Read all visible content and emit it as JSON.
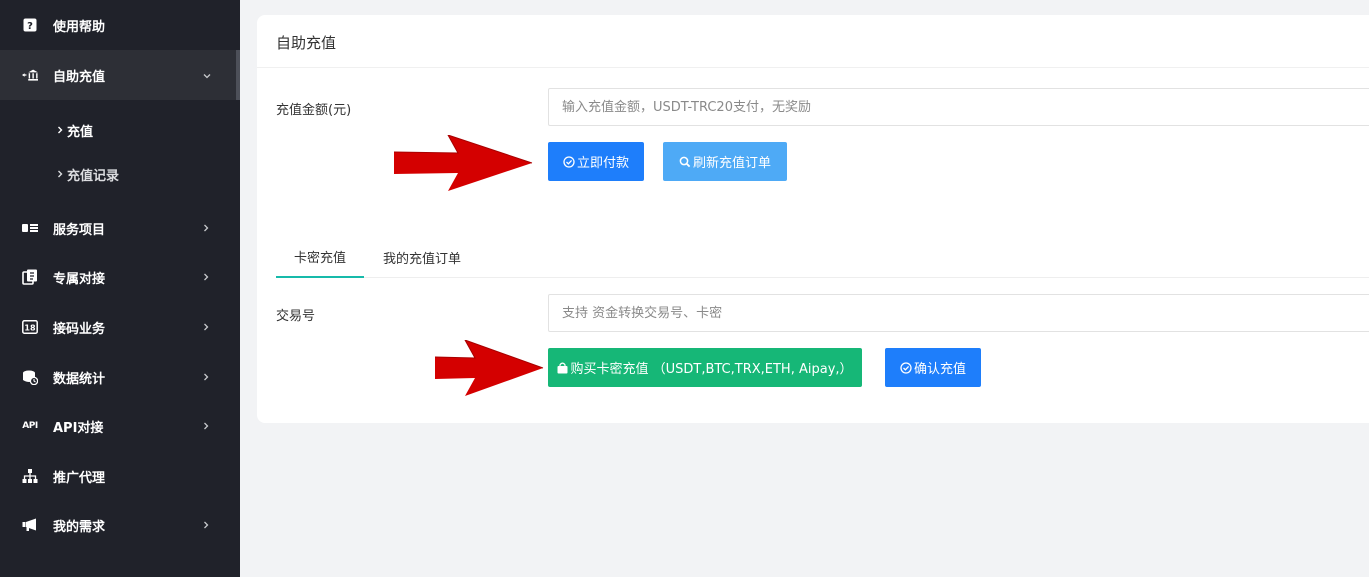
{
  "sidebar": {
    "items": [
      {
        "label": "使用帮助",
        "icon": "help-icon"
      },
      {
        "label": "自助充值",
        "icon": "bank-icon",
        "expanded": true
      },
      {
        "label": "服务项目",
        "icon": "list-icon"
      },
      {
        "label": "专属对接",
        "icon": "connect-icon"
      },
      {
        "label": "接码业务",
        "icon": "sms-icon"
      },
      {
        "label": "数据统计",
        "icon": "stats-icon"
      },
      {
        "label": "API对接",
        "icon": "api-icon"
      },
      {
        "label": "推广代理",
        "icon": "sitemap-icon"
      },
      {
        "label": "我的需求",
        "icon": "megaphone-icon"
      }
    ],
    "subitems": [
      {
        "label": "充值"
      },
      {
        "label": "充值记录"
      }
    ],
    "api_icon_text": "API"
  },
  "main": {
    "title": "自助充值",
    "amount": {
      "label": "充值金额(元)",
      "placeholder": "输入充值金额，USDT-TRC20支付，无奖励"
    },
    "pay_button": "立即付款",
    "refresh_button": "刷新充值订单",
    "tabs": [
      "卡密充值",
      "我的充值订单"
    ],
    "transaction": {
      "label": "交易号",
      "placeholder": "支持 资金转换交易号、卡密"
    },
    "buy_button": "购买卡密充值 （USDT,BTC,TRX,ETH, Aipay,）",
    "confirm_button": "确认充值"
  },
  "colors": {
    "sidebar_bg": "#20222a",
    "primary": "#1e7efb",
    "light_blue": "#4eaaf6",
    "green": "#16b777",
    "arrow_red": "#d40000"
  }
}
